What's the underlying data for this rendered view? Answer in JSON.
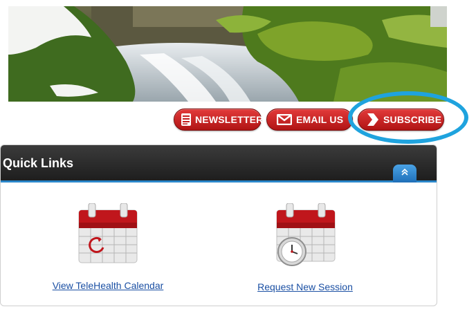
{
  "header": {
    "buttons": [
      {
        "label": "NEWSLETTER",
        "icon": "newsletter-icon"
      },
      {
        "label": "EMAIL US",
        "icon": "envelope-icon"
      },
      {
        "label": "SUBSCRIBE",
        "icon": "chevron-right-icon"
      }
    ],
    "highlighted_button": "SUBSCRIBE"
  },
  "quick_links": {
    "title": "Quick Links",
    "items": [
      {
        "label": "View TeleHealth Calendar",
        "icon": "calendar-refresh-icon"
      },
      {
        "label": "Request New Session",
        "icon": "calendar-clock-icon"
      }
    ]
  },
  "colors": {
    "button_red": "#c41e1e",
    "link_blue": "#1a4fa3",
    "highlight_blue": "#1fa3de",
    "panel_header_dark": "#2a2a2a",
    "panel_accent_blue": "#2a86c9"
  }
}
